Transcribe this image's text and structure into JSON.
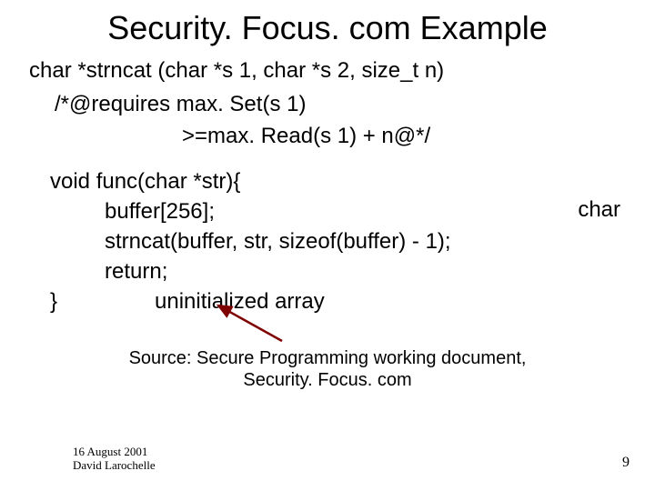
{
  "title": "Security. Focus. com Example",
  "sig": "char *strncat (char *s 1, char *s 2, size_t n)",
  "req1": "/*@requires max. Set(s 1)",
  "req2": ">=max. Read(s 1) + n@*/",
  "void_line": "void func(char *str){",
  "char_right": "char",
  "body1": "buffer[256];",
  "body2": "strncat(buffer, str, sizeof(buffer) - 1);",
  "body3": "return;",
  "close": "}",
  "annot": "uninitialized array",
  "source1": "Source: Secure Programming working document,",
  "source2": "Security. Focus. com",
  "date": "16 August 2001",
  "author": "David Larochelle",
  "page": "9",
  "arrow_color": "#7f0000"
}
